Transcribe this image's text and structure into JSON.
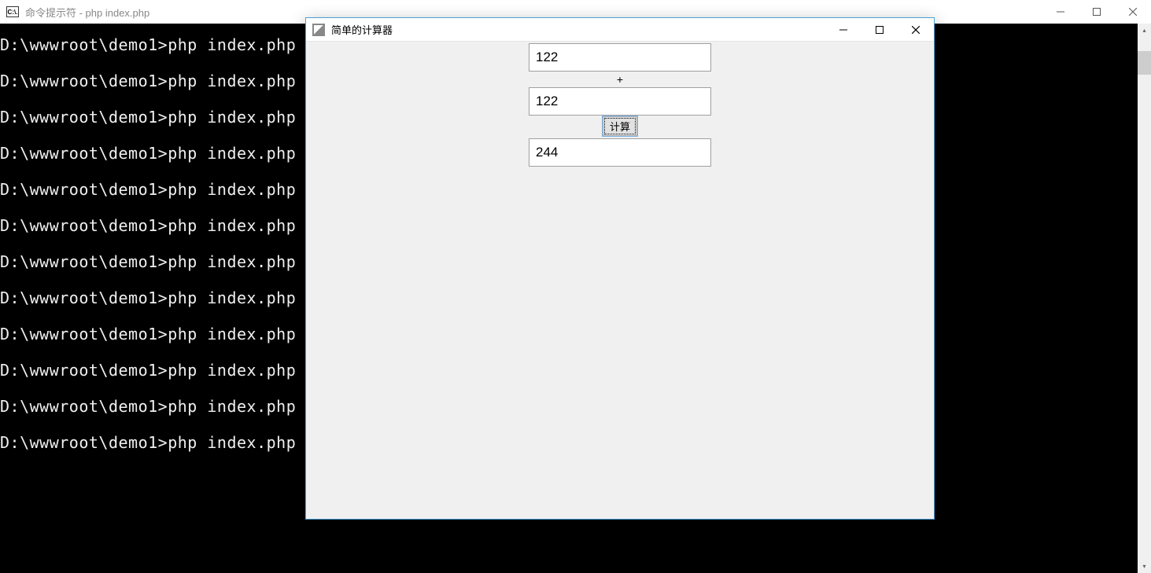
{
  "cmd": {
    "title": "命令提示符 - php  index.php",
    "icon_text": "C:\\.",
    "lines": [
      "D:\\wwwroot\\demo1>php index.php",
      "D:\\wwwroot\\demo1>php index.php",
      "D:\\wwwroot\\demo1>php index.php",
      "D:\\wwwroot\\demo1>php index.php",
      "D:\\wwwroot\\demo1>php index.php",
      "D:\\wwwroot\\demo1>php index.php",
      "D:\\wwwroot\\demo1>php index.php",
      "D:\\wwwroot\\demo1>php index.php",
      "D:\\wwwroot\\demo1>php index.php",
      "D:\\wwwroot\\demo1>php index.php",
      "D:\\wwwroot\\demo1>php index.php",
      "D:\\wwwroot\\demo1>php index.php"
    ]
  },
  "calc": {
    "title": "简单的计算器",
    "input1": "122",
    "operator": "+",
    "input2": "122",
    "button_label": "计算",
    "result": "244"
  }
}
